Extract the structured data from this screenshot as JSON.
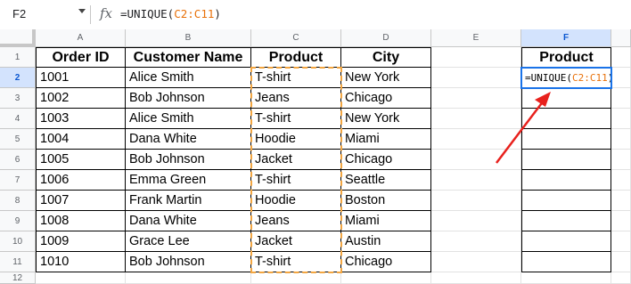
{
  "formula_bar": {
    "cell_ref": "F2",
    "fx_icon": "fx-icon",
    "formula_prefix": "=UNIQUE(",
    "formula_range": "C2:C11",
    "formula_suffix": ")"
  },
  "columns": [
    "A",
    "B",
    "C",
    "D",
    "E",
    "F"
  ],
  "rows": [
    "1",
    "2",
    "3",
    "4",
    "5",
    "6",
    "7",
    "8",
    "9",
    "10",
    "11",
    "12"
  ],
  "table": {
    "headers": [
      "Order ID",
      "Customer Name",
      "Product",
      "City"
    ],
    "rows": [
      [
        "1001",
        "Alice Smith",
        "T-shirt",
        "New York"
      ],
      [
        "1002",
        "Bob Johnson",
        "Jeans",
        "Chicago"
      ],
      [
        "1003",
        "Alice Smith",
        "T-shirt",
        "New York"
      ],
      [
        "1004",
        "Dana White",
        "Hoodie",
        "Miami"
      ],
      [
        "1005",
        "Bob Johnson",
        "Jacket",
        "Chicago"
      ],
      [
        "1006",
        "Emma Green",
        "T-shirt",
        "Seattle"
      ],
      [
        "1007",
        "Frank Martin",
        "Hoodie",
        "Boston"
      ],
      [
        "1008",
        "Dana White",
        "Jeans",
        "Miami"
      ],
      [
        "1009",
        "Grace Lee",
        "Jacket",
        "Austin"
      ],
      [
        "1010",
        "Bob Johnson",
        "T-shirt",
        "Chicago"
      ]
    ]
  },
  "result": {
    "header": "Product",
    "formula_prefix": "=UNIQUE(",
    "formula_range": "C2:C11",
    "formula_suffix": ")"
  },
  "colors": {
    "selection": "#1a73e8",
    "range_highlight": "#f4a640",
    "arrow": "#e8211d"
  }
}
